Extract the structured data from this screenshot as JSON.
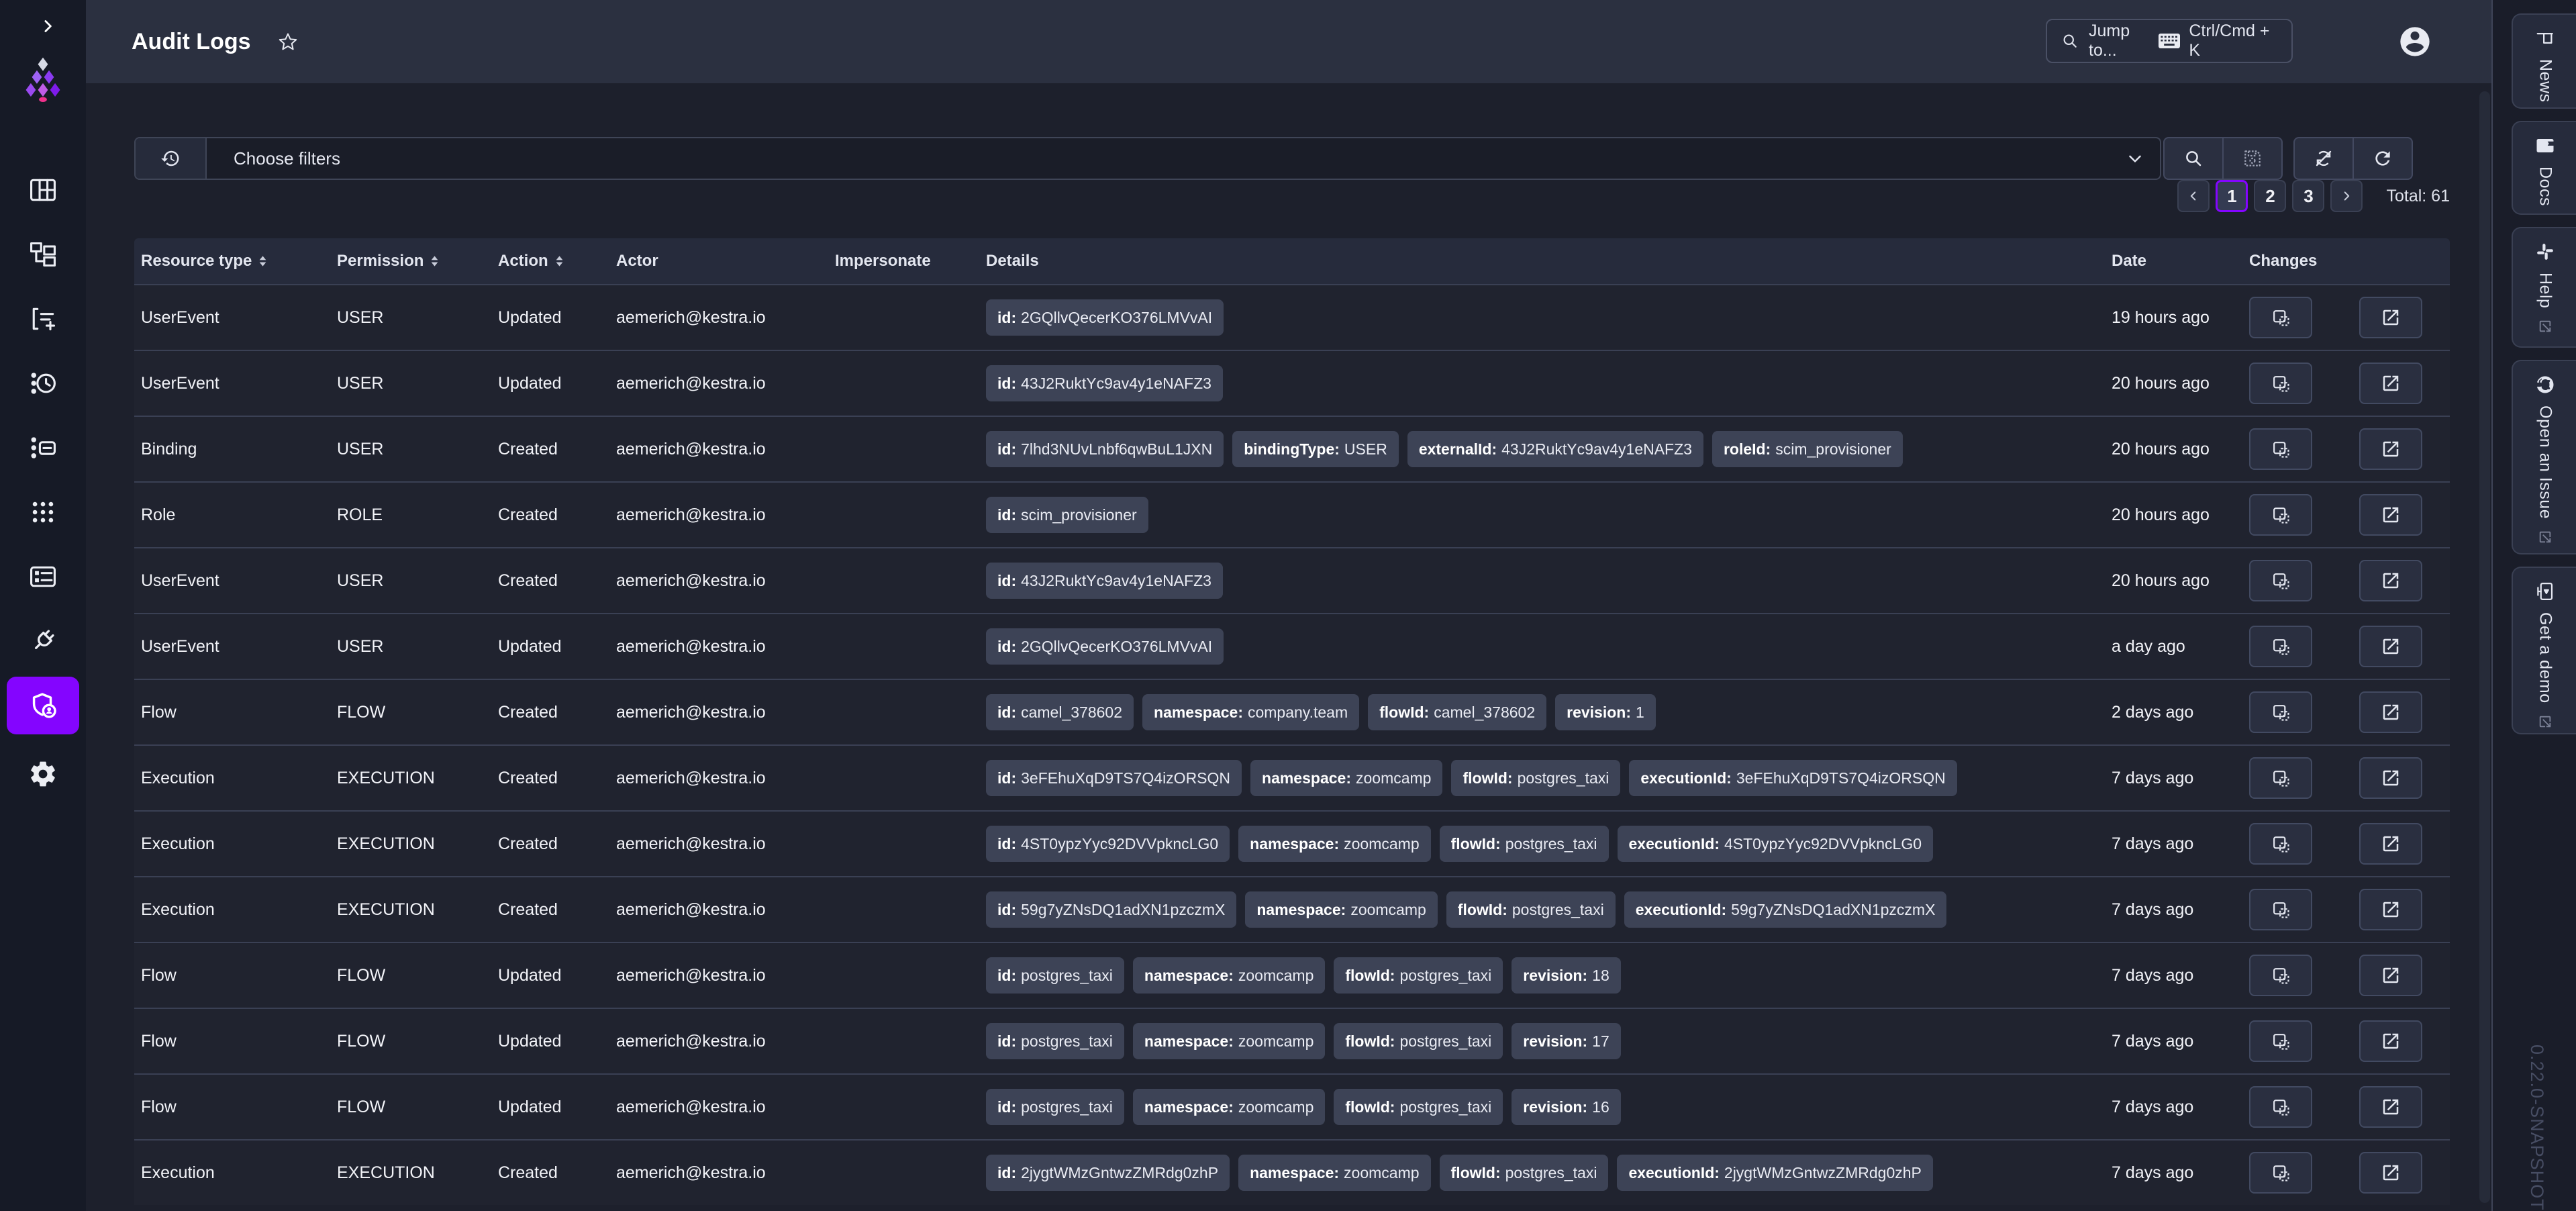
{
  "app": {
    "title": "Audit Logs",
    "version": "0.22.0-SNAPSHOT"
  },
  "colors": {
    "accent": "#8405FF",
    "logo_pink": "#F0318C",
    "topbar_bg": "#2B3040",
    "content_bg": "#1D202C",
    "badge_bg": "#3D4356"
  },
  "topbar": {
    "search_placeholder": "Jump to...",
    "search_shortcut": "Ctrl/Cmd + K",
    "search_icon": "magnify-icon",
    "avatar_icon": "account-circle-icon"
  },
  "sidebar": {
    "items": [
      {
        "icon": "dashboard-icon"
      },
      {
        "icon": "flows-icon"
      },
      {
        "icon": "executions-icon"
      },
      {
        "icon": "logs-icon"
      },
      {
        "icon": "namespaces-icon"
      },
      {
        "icon": "blueprints-icon"
      },
      {
        "icon": "apps-icon"
      },
      {
        "icon": "administration-icon"
      },
      {
        "icon": "iam-shield-account-icon",
        "active": true
      },
      {
        "icon": "settings-gear-icon"
      }
    ]
  },
  "filter": {
    "placeholder": "Choose filters",
    "history_icon": "history-icon",
    "chevron_icon": "chevron-down-icon",
    "search_icon": "magnify-icon",
    "save_icon": "save-icon",
    "auto_refresh_icon": "sync-off-icon",
    "refresh_icon": "refresh-icon"
  },
  "pagination": {
    "prev_icon": "chevron-left-icon",
    "next_icon": "chevron-right-icon",
    "pages": [
      "1",
      "2",
      "3"
    ],
    "active_page": "1",
    "total_label": "Total: 61"
  },
  "table": {
    "columns": [
      {
        "label": "Resource type",
        "sortable": true
      },
      {
        "label": "Permission",
        "sortable": true
      },
      {
        "label": "Action",
        "sortable": true
      },
      {
        "label": "Actor",
        "sortable": false
      },
      {
        "label": "Impersonate",
        "sortable": false
      },
      {
        "label": "Details",
        "sortable": false
      },
      {
        "label": "Date",
        "sortable": false
      },
      {
        "label": "Changes",
        "sortable": false
      }
    ],
    "rows": [
      {
        "resource_type": "UserEvent",
        "permission": "USER",
        "action": "Updated",
        "actor": "aemerich@kestra.io",
        "impersonate": "",
        "details": [
          {
            "key": "id",
            "value": "2GQllvQecerKO376LMVvAI"
          }
        ],
        "date": "19 hours ago"
      },
      {
        "resource_type": "UserEvent",
        "permission": "USER",
        "action": "Updated",
        "actor": "aemerich@kestra.io",
        "impersonate": "",
        "details": [
          {
            "key": "id",
            "value": "43J2RuktYc9av4y1eNAFZ3"
          }
        ],
        "date": "20 hours ago"
      },
      {
        "resource_type": "Binding",
        "permission": "USER",
        "action": "Created",
        "actor": "aemerich@kestra.io",
        "impersonate": "",
        "details": [
          {
            "key": "id",
            "value": "7lhd3NUvLnbf6qwBuL1JXN"
          },
          {
            "key": "bindingType",
            "value": "USER"
          },
          {
            "key": "externalId",
            "value": "43J2RuktYc9av4y1eNAFZ3"
          },
          {
            "key": "roleId",
            "value": "scim_provisioner"
          }
        ],
        "date": "20 hours ago"
      },
      {
        "resource_type": "Role",
        "permission": "ROLE",
        "action": "Created",
        "actor": "aemerich@kestra.io",
        "impersonate": "",
        "details": [
          {
            "key": "id",
            "value": "scim_provisioner"
          }
        ],
        "date": "20 hours ago"
      },
      {
        "resource_type": "UserEvent",
        "permission": "USER",
        "action": "Created",
        "actor": "aemerich@kestra.io",
        "impersonate": "",
        "details": [
          {
            "key": "id",
            "value": "43J2RuktYc9av4y1eNAFZ3"
          }
        ],
        "date": "20 hours ago"
      },
      {
        "resource_type": "UserEvent",
        "permission": "USER",
        "action": "Updated",
        "actor": "aemerich@kestra.io",
        "impersonate": "",
        "details": [
          {
            "key": "id",
            "value": "2GQllvQecerKO376LMVvAI"
          }
        ],
        "date": "a day ago"
      },
      {
        "resource_type": "Flow",
        "permission": "FLOW",
        "action": "Created",
        "actor": "aemerich@kestra.io",
        "impersonate": "",
        "details": [
          {
            "key": "id",
            "value": "camel_378602"
          },
          {
            "key": "namespace",
            "value": "company.team"
          },
          {
            "key": "flowId",
            "value": "camel_378602"
          },
          {
            "key": "revision",
            "value": "1"
          }
        ],
        "date": "2 days ago"
      },
      {
        "resource_type": "Execution",
        "permission": "EXECUTION",
        "action": "Created",
        "actor": "aemerich@kestra.io",
        "impersonate": "",
        "details": [
          {
            "key": "id",
            "value": "3eFEhuXqD9TS7Q4izORSQN"
          },
          {
            "key": "namespace",
            "value": "zoomcamp"
          },
          {
            "key": "flowId",
            "value": "postgres_taxi"
          },
          {
            "key": "executionId",
            "value": "3eFEhuXqD9TS7Q4izORSQN"
          }
        ],
        "date": "7 days ago"
      },
      {
        "resource_type": "Execution",
        "permission": "EXECUTION",
        "action": "Created",
        "actor": "aemerich@kestra.io",
        "impersonate": "",
        "details": [
          {
            "key": "id",
            "value": "4ST0ypzYyc92DVVpkncLG0"
          },
          {
            "key": "namespace",
            "value": "zoomcamp"
          },
          {
            "key": "flowId",
            "value": "postgres_taxi"
          },
          {
            "key": "executionId",
            "value": "4ST0ypzYyc92DVVpkncLG0"
          }
        ],
        "date": "7 days ago"
      },
      {
        "resource_type": "Execution",
        "permission": "EXECUTION",
        "action": "Created",
        "actor": "aemerich@kestra.io",
        "impersonate": "",
        "details": [
          {
            "key": "id",
            "value": "59g7yZNsDQ1adXN1pzczmX"
          },
          {
            "key": "namespace",
            "value": "zoomcamp"
          },
          {
            "key": "flowId",
            "value": "postgres_taxi"
          },
          {
            "key": "executionId",
            "value": "59g7yZNsDQ1adXN1pzczmX"
          }
        ],
        "date": "7 days ago"
      },
      {
        "resource_type": "Flow",
        "permission": "FLOW",
        "action": "Updated",
        "actor": "aemerich@kestra.io",
        "impersonate": "",
        "details": [
          {
            "key": "id",
            "value": "postgres_taxi"
          },
          {
            "key": "namespace",
            "value": "zoomcamp"
          },
          {
            "key": "flowId",
            "value": "postgres_taxi"
          },
          {
            "key": "revision",
            "value": "18"
          }
        ],
        "date": "7 days ago"
      },
      {
        "resource_type": "Flow",
        "permission": "FLOW",
        "action": "Updated",
        "actor": "aemerich@kestra.io",
        "impersonate": "",
        "details": [
          {
            "key": "id",
            "value": "postgres_taxi"
          },
          {
            "key": "namespace",
            "value": "zoomcamp"
          },
          {
            "key": "flowId",
            "value": "postgres_taxi"
          },
          {
            "key": "revision",
            "value": "17"
          }
        ],
        "date": "7 days ago"
      },
      {
        "resource_type": "Flow",
        "permission": "FLOW",
        "action": "Updated",
        "actor": "aemerich@kestra.io",
        "impersonate": "",
        "details": [
          {
            "key": "id",
            "value": "postgres_taxi"
          },
          {
            "key": "namespace",
            "value": "zoomcamp"
          },
          {
            "key": "flowId",
            "value": "postgres_taxi"
          },
          {
            "key": "revision",
            "value": "16"
          }
        ],
        "date": "7 days ago"
      },
      {
        "resource_type": "Execution",
        "permission": "EXECUTION",
        "action": "Created",
        "actor": "aemerich@kestra.io",
        "impersonate": "",
        "details": [
          {
            "key": "id",
            "value": "2jygtWMzGntwzZMRdg0zhP"
          },
          {
            "key": "namespace",
            "value": "zoomcamp"
          },
          {
            "key": "flowId",
            "value": "postgres_taxi"
          },
          {
            "key": "executionId",
            "value": "2jygtWMzGntwzZMRdg0zhP"
          }
        ],
        "date": "7 days ago"
      }
    ],
    "row_action_icons": [
      "diff-revisions-icon",
      "open-in-new-icon"
    ]
  },
  "right_rail": {
    "tabs": [
      {
        "label": "News",
        "icon": "flag-icon",
        "external": false
      },
      {
        "label": "Docs",
        "icon": "book-icon",
        "external": false
      },
      {
        "label": "Help",
        "icon": "slack-icon",
        "external": true
      },
      {
        "label": "Open an Issue",
        "icon": "github-icon",
        "external": true
      },
      {
        "label": "Get a demo",
        "icon": "demo-screen-icon",
        "external": true
      }
    ]
  }
}
